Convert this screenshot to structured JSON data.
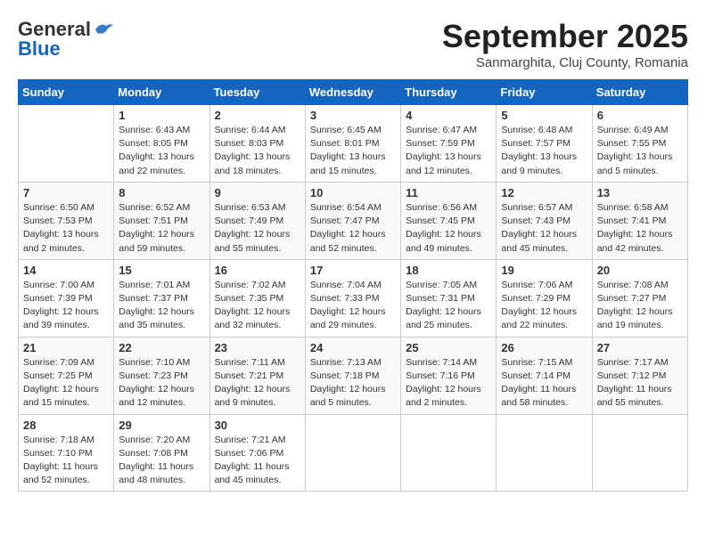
{
  "header": {
    "logo_general": "General",
    "logo_blue": "Blue",
    "month_title": "September 2025",
    "subtitle": "Sanmarghita, Cluj County, Romania"
  },
  "weekdays": [
    "Sunday",
    "Monday",
    "Tuesday",
    "Wednesday",
    "Thursday",
    "Friday",
    "Saturday"
  ],
  "weeks": [
    [
      {
        "day": "",
        "info": ""
      },
      {
        "day": "1",
        "info": "Sunrise: 6:43 AM\nSunset: 8:05 PM\nDaylight: 13 hours\nand 22 minutes."
      },
      {
        "day": "2",
        "info": "Sunrise: 6:44 AM\nSunset: 8:03 PM\nDaylight: 13 hours\nand 18 minutes."
      },
      {
        "day": "3",
        "info": "Sunrise: 6:45 AM\nSunset: 8:01 PM\nDaylight: 13 hours\nand 15 minutes."
      },
      {
        "day": "4",
        "info": "Sunrise: 6:47 AM\nSunset: 7:59 PM\nDaylight: 13 hours\nand 12 minutes."
      },
      {
        "day": "5",
        "info": "Sunrise: 6:48 AM\nSunset: 7:57 PM\nDaylight: 13 hours\nand 9 minutes."
      },
      {
        "day": "6",
        "info": "Sunrise: 6:49 AM\nSunset: 7:55 PM\nDaylight: 13 hours\nand 5 minutes."
      }
    ],
    [
      {
        "day": "7",
        "info": "Sunrise: 6:50 AM\nSunset: 7:53 PM\nDaylight: 13 hours\nand 2 minutes."
      },
      {
        "day": "8",
        "info": "Sunrise: 6:52 AM\nSunset: 7:51 PM\nDaylight: 12 hours\nand 59 minutes."
      },
      {
        "day": "9",
        "info": "Sunrise: 6:53 AM\nSunset: 7:49 PM\nDaylight: 12 hours\nand 55 minutes."
      },
      {
        "day": "10",
        "info": "Sunrise: 6:54 AM\nSunset: 7:47 PM\nDaylight: 12 hours\nand 52 minutes."
      },
      {
        "day": "11",
        "info": "Sunrise: 6:56 AM\nSunset: 7:45 PM\nDaylight: 12 hours\nand 49 minutes."
      },
      {
        "day": "12",
        "info": "Sunrise: 6:57 AM\nSunset: 7:43 PM\nDaylight: 12 hours\nand 45 minutes."
      },
      {
        "day": "13",
        "info": "Sunrise: 6:58 AM\nSunset: 7:41 PM\nDaylight: 12 hours\nand 42 minutes."
      }
    ],
    [
      {
        "day": "14",
        "info": "Sunrise: 7:00 AM\nSunset: 7:39 PM\nDaylight: 12 hours\nand 39 minutes."
      },
      {
        "day": "15",
        "info": "Sunrise: 7:01 AM\nSunset: 7:37 PM\nDaylight: 12 hours\nand 35 minutes."
      },
      {
        "day": "16",
        "info": "Sunrise: 7:02 AM\nSunset: 7:35 PM\nDaylight: 12 hours\nand 32 minutes."
      },
      {
        "day": "17",
        "info": "Sunrise: 7:04 AM\nSunset: 7:33 PM\nDaylight: 12 hours\nand 29 minutes."
      },
      {
        "day": "18",
        "info": "Sunrise: 7:05 AM\nSunset: 7:31 PM\nDaylight: 12 hours\nand 25 minutes."
      },
      {
        "day": "19",
        "info": "Sunrise: 7:06 AM\nSunset: 7:29 PM\nDaylight: 12 hours\nand 22 minutes."
      },
      {
        "day": "20",
        "info": "Sunrise: 7:08 AM\nSunset: 7:27 PM\nDaylight: 12 hours\nand 19 minutes."
      }
    ],
    [
      {
        "day": "21",
        "info": "Sunrise: 7:09 AM\nSunset: 7:25 PM\nDaylight: 12 hours\nand 15 minutes."
      },
      {
        "day": "22",
        "info": "Sunrise: 7:10 AM\nSunset: 7:23 PM\nDaylight: 12 hours\nand 12 minutes."
      },
      {
        "day": "23",
        "info": "Sunrise: 7:11 AM\nSunset: 7:21 PM\nDaylight: 12 hours\nand 9 minutes."
      },
      {
        "day": "24",
        "info": "Sunrise: 7:13 AM\nSunset: 7:18 PM\nDaylight: 12 hours\nand 5 minutes."
      },
      {
        "day": "25",
        "info": "Sunrise: 7:14 AM\nSunset: 7:16 PM\nDaylight: 12 hours\nand 2 minutes."
      },
      {
        "day": "26",
        "info": "Sunrise: 7:15 AM\nSunset: 7:14 PM\nDaylight: 11 hours\nand 58 minutes."
      },
      {
        "day": "27",
        "info": "Sunrise: 7:17 AM\nSunset: 7:12 PM\nDaylight: 11 hours\nand 55 minutes."
      }
    ],
    [
      {
        "day": "28",
        "info": "Sunrise: 7:18 AM\nSunset: 7:10 PM\nDaylight: 11 hours\nand 52 minutes."
      },
      {
        "day": "29",
        "info": "Sunrise: 7:20 AM\nSunset: 7:08 PM\nDaylight: 11 hours\nand 48 minutes."
      },
      {
        "day": "30",
        "info": "Sunrise: 7:21 AM\nSunset: 7:06 PM\nDaylight: 11 hours\nand 45 minutes."
      },
      {
        "day": "",
        "info": ""
      },
      {
        "day": "",
        "info": ""
      },
      {
        "day": "",
        "info": ""
      },
      {
        "day": "",
        "info": ""
      }
    ]
  ]
}
